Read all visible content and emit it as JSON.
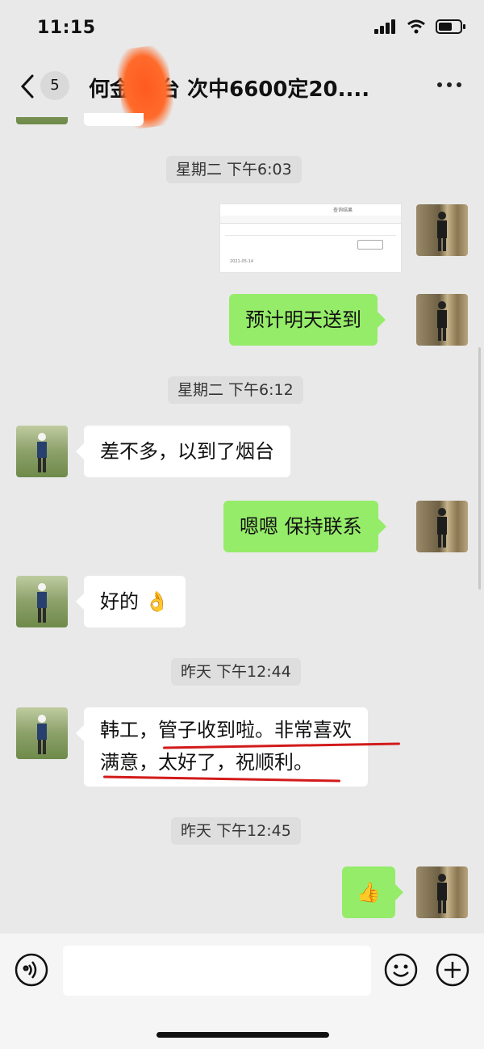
{
  "status_bar": {
    "time": "11:15"
  },
  "header": {
    "back_count": "5",
    "title": "何金  烟台 次中6600定20...."
  },
  "messages": {
    "ts1": "星期二 下午6:03",
    "m1_text": "预计明天送到",
    "ts2": "星期二 下午6:12",
    "m2_text": "差不多，以到了烟台",
    "m3_text": "嗯嗯  保持联系",
    "m4_text": "好的 👌",
    "ts3": "昨天 下午12:44",
    "m5_line1": "韩工，管子收到啦。非常喜欢",
    "m5_line2": "满意，太好了，祝顺利。",
    "ts4": "昨天 下午12:45",
    "m6_text": "👍"
  },
  "screenshot_thumbnail": {
    "header": "查询结果",
    "date": "2021-05-14"
  },
  "colors": {
    "self_bubble": "#95ec69",
    "other_bubble": "#ffffff",
    "underline": "#d21a1a"
  }
}
